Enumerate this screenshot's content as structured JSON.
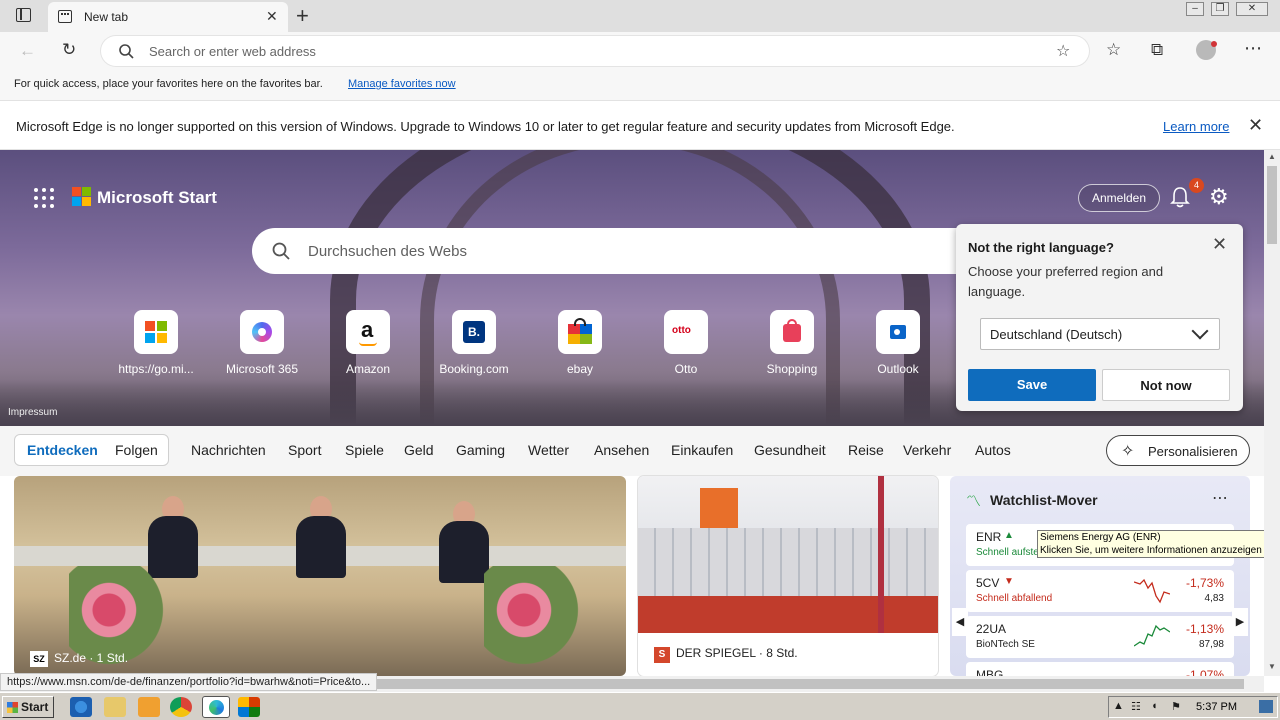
{
  "browser": {
    "tab_title": "New tab",
    "address_placeholder": "Search or enter web address",
    "favbar_text": "For quick access, place your favorites here on the favorites bar.",
    "favbar_link": "Manage favorites now",
    "info_text": "Microsoft Edge is no longer supported on this version of Windows. Upgrade to Windows 10 or later to get regular feature and security updates from Microsoft Edge.",
    "info_link": "Learn more"
  },
  "start": {
    "brand": "Microsoft Start",
    "signin": "Anmelden",
    "notification_count": "4",
    "search_placeholder": "Durchsuchen des Webs",
    "impressum": "Impressum",
    "tiles": [
      {
        "label": "https://go.mi...",
        "icon": "windows-icon"
      },
      {
        "label": "Microsoft 365",
        "icon": "m365-icon"
      },
      {
        "label": "Amazon",
        "icon": "amazon-icon"
      },
      {
        "label": "Booking.com",
        "icon": "booking-icon"
      },
      {
        "label": "ebay",
        "icon": "ebay-icon"
      },
      {
        "label": "Otto",
        "icon": "otto-icon"
      },
      {
        "label": "Shopping",
        "icon": "shopping-bag-icon"
      },
      {
        "label": "Outlook",
        "icon": "outlook-icon"
      }
    ]
  },
  "language_popup": {
    "title": "Not the right language?",
    "description": "Choose your preferred region and language.",
    "selected": "Deutschland (Deutsch)",
    "save": "Save",
    "not_now": "Not now"
  },
  "nav": {
    "items": [
      "Entdecken",
      "Folgen",
      "Nachrichten",
      "Sport",
      "Spiele",
      "Geld",
      "Gaming",
      "Wetter",
      "Ansehen",
      "Einkaufen",
      "Gesundheit",
      "Reise",
      "Verkehr",
      "Autos"
    ],
    "personalize": "Personalisieren"
  },
  "cards": {
    "main_source": "SZ.de · 1 Std.",
    "main_logo": "SZ",
    "ship_source": "DER SPIEGEL · 8 Std.",
    "ship_logo": "S"
  },
  "watchlist": {
    "title": "Watchlist-Mover",
    "rows": [
      {
        "symbol": "ENR",
        "name": "Schnell aufste",
        "pct": "",
        "price": "",
        "trend": "up"
      },
      {
        "symbol": "5CV",
        "name": "Schnell abfallend",
        "pct": "-1,73%",
        "price": "4,83",
        "trend": "down"
      },
      {
        "symbol": "22UA",
        "name": "BioNTech SE",
        "pct": "-1,13%",
        "price": "87,98",
        "trend": "down"
      },
      {
        "symbol": "MBG",
        "name": "",
        "pct": "-1,07%",
        "price": "",
        "trend": "down"
      }
    ]
  },
  "tooltip": {
    "line1": "Siemens Energy AG (ENR)",
    "line2": "Klicken Sie, um weitere Informationen anzuzeigen"
  },
  "status_url": "https://www.msn.com/de-de/finanzen/portfolio?id=bwarhw&noti=Price&to...",
  "taskbar": {
    "start": "Start",
    "clock": "5:37 PM"
  },
  "colors": {
    "accent": "#0f6cbd",
    "negative": "#c42b1c",
    "positive": "#1b8a3a"
  }
}
